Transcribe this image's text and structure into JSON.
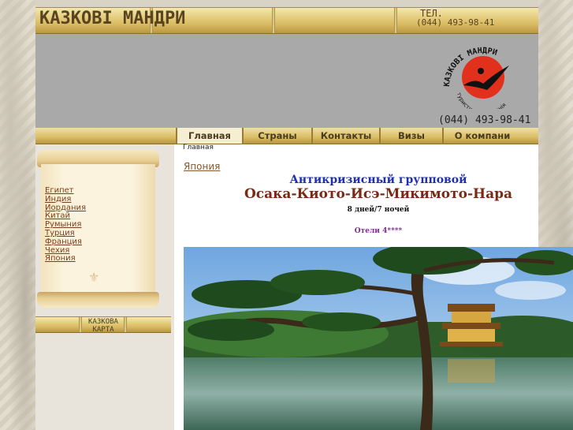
{
  "header": {
    "logo_text": "КАЗКОВІ МАНДРИ",
    "tel_label": "ТЕЛ.",
    "tel_number": "(044) 493-98-41"
  },
  "banner": {
    "emblem_text": "КАЗКОВІ МАНДРИ",
    "emblem_subtitle": "туристична компанія",
    "phone": "(044) 493-98-41"
  },
  "nav": {
    "items": [
      {
        "label": "Главная"
      },
      {
        "label": "Страны"
      },
      {
        "label": "Контакты"
      },
      {
        "label": "Визы"
      },
      {
        "label": "О компани"
      }
    ]
  },
  "breadcrumb": "Главная",
  "sidebar": {
    "items": [
      {
        "label": "Египет"
      },
      {
        "label": "Индия"
      },
      {
        "label": "Иордания"
      },
      {
        "label": "Китай"
      },
      {
        "label": "Румыния"
      },
      {
        "label": "Турция"
      },
      {
        "label": "Франция"
      },
      {
        "label": "Чехия"
      },
      {
        "label": "Япония"
      }
    ],
    "map_button": {
      "line1": "КАЗКОВА",
      "line2": "КАРТА"
    }
  },
  "content": {
    "page_link": "Япония",
    "title_line1": "Антикризисный групповой",
    "title_line2": "Осака-Киото-Исэ-Микимото-Нара",
    "duration": "8 дней/7 ночей",
    "hotels": "Отели 4****"
  },
  "colors": {
    "bamboo": "#d8bb62",
    "banner_bg": "#a9a9a9",
    "title_blue": "#1f2fb0",
    "title_brown": "#7a2a14",
    "link_brown": "#7a3f1a",
    "hotels_purple": "#7a2f8a"
  }
}
